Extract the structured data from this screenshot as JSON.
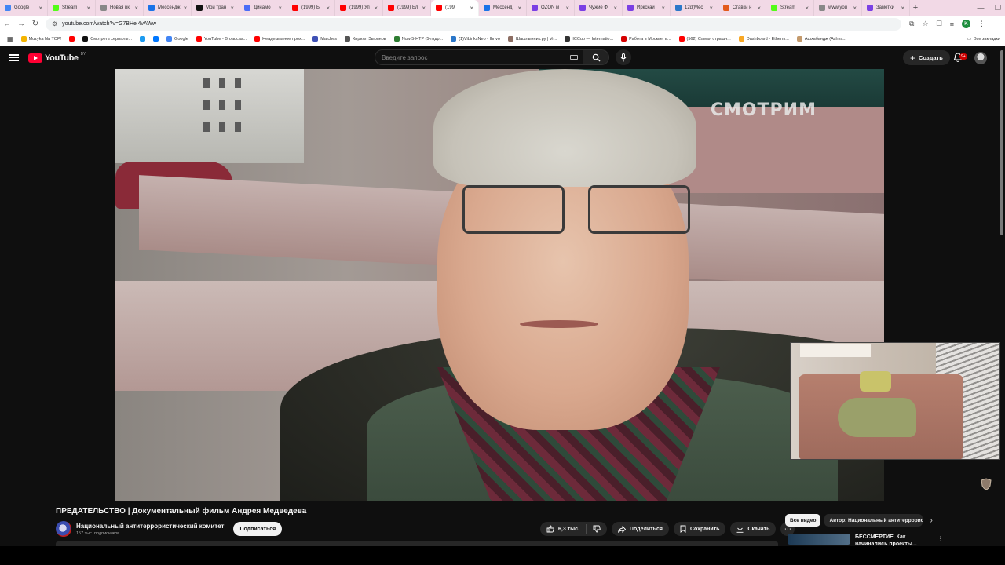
{
  "browser": {
    "tabs": [
      {
        "label": "Google",
        "color": "#4285f4"
      },
      {
        "label": "Stream",
        "color": "#53fc18"
      },
      {
        "label": "Новая вк",
        "color": "#888888"
      },
      {
        "label": "Мессендж",
        "color": "#1a73e8"
      },
      {
        "label": "Мои тран",
        "color": "#111111"
      },
      {
        "label": "Динамо",
        "color": "#4a6cf7"
      },
      {
        "label": "(1999) Б",
        "color": "#ff0000"
      },
      {
        "label": "(1999) Уп",
        "color": "#ff0000"
      },
      {
        "label": "(1999) Бл",
        "color": "#ff0000"
      },
      {
        "label": "(199",
        "color": "#ff0000"
      },
      {
        "label": "Мессенд",
        "color": "#1a73e8"
      },
      {
        "label": "OZON м",
        "color": "#7b3fe4"
      },
      {
        "label": "Чужие Ф",
        "color": "#7b3fe4"
      },
      {
        "label": "Иркскай",
        "color": "#7b3fe4"
      },
      {
        "label": "12d(Мес",
        "color": "#2b77c9"
      },
      {
        "label": "Ставки н",
        "color": "#e35a1c"
      },
      {
        "label": "Stream",
        "color": "#53fc18"
      },
      {
        "label": "www.you",
        "color": "#888888"
      },
      {
        "label": "Заметки",
        "color": "#7b3fe4"
      }
    ],
    "url": "youtube.com/watch?v=G7BHel4vAWw",
    "bookmarks": [
      {
        "label": "Muzyka Na TOP!",
        "color": "#f4b400"
      },
      {
        "label": "",
        "color": "#ff0000"
      },
      {
        "label": "Смотреть сериалы...",
        "color": "#111111"
      },
      {
        "label": "",
        "color": "#1d9bf0"
      },
      {
        "label": "",
        "color": "#0077ff"
      },
      {
        "label": "Google",
        "color": "#4285f4"
      },
      {
        "label": "YouTube - Broadcas...",
        "color": "#ff0000"
      },
      {
        "label": "Неадекватное прох...",
        "color": "#ff0000"
      },
      {
        "label": "Matches",
        "color": "#3f51b5"
      },
      {
        "label": "Кирилл Зырянов",
        "color": "#555555"
      },
      {
        "label": "Now 5-HTP (5-гидр...",
        "color": "#2e7d32"
      },
      {
        "label": "(1)ViLinksNeo - Ihnvo",
        "color": "#2b77c9"
      },
      {
        "label": "Шашлычник.ру | Vr...",
        "color": "#8d6e63"
      },
      {
        "label": "ICCup — Internatio...",
        "color": "#333333"
      },
      {
        "label": "Работа в Москве, в...",
        "color": "#d50000"
      },
      {
        "label": "(562) Самая страшн...",
        "color": "#ff0000"
      },
      {
        "label": "Dashboard - Etherm...",
        "color": "#f9a825"
      },
      {
        "label": "Ашхабандж (Ashva...",
        "color": "#c49a6c"
      }
    ],
    "all_bookmarks": "Все закладки",
    "profile_letter": "K"
  },
  "youtube": {
    "logo_text": "YouTube",
    "logo_country": "BY",
    "search_placeholder": "Введите запрос",
    "create_label": "Создать",
    "notif_count": "9+",
    "watermark": "СМОТРИМ",
    "video_title": "ПРЕДАТЕЛЬСТВО | Документальный фильм Андрея Медведева",
    "channel_name": "Национальный антитеррористический комитет",
    "channel_subs": "157 тыс. подписчиков",
    "subscribe_label": "Подписаться",
    "like_count": "6,3 тыс.",
    "share_label": "Поделиться",
    "save_label": "Сохранить",
    "download_label": "Скачать",
    "chips": [
      {
        "label": "Все видео",
        "active": true
      },
      {
        "label": "Автор: Национальный антитеррористический комитет",
        "active": false
      }
    ],
    "rec_title": "БЕССМЕРТИЕ. Как начинались проекты..."
  }
}
